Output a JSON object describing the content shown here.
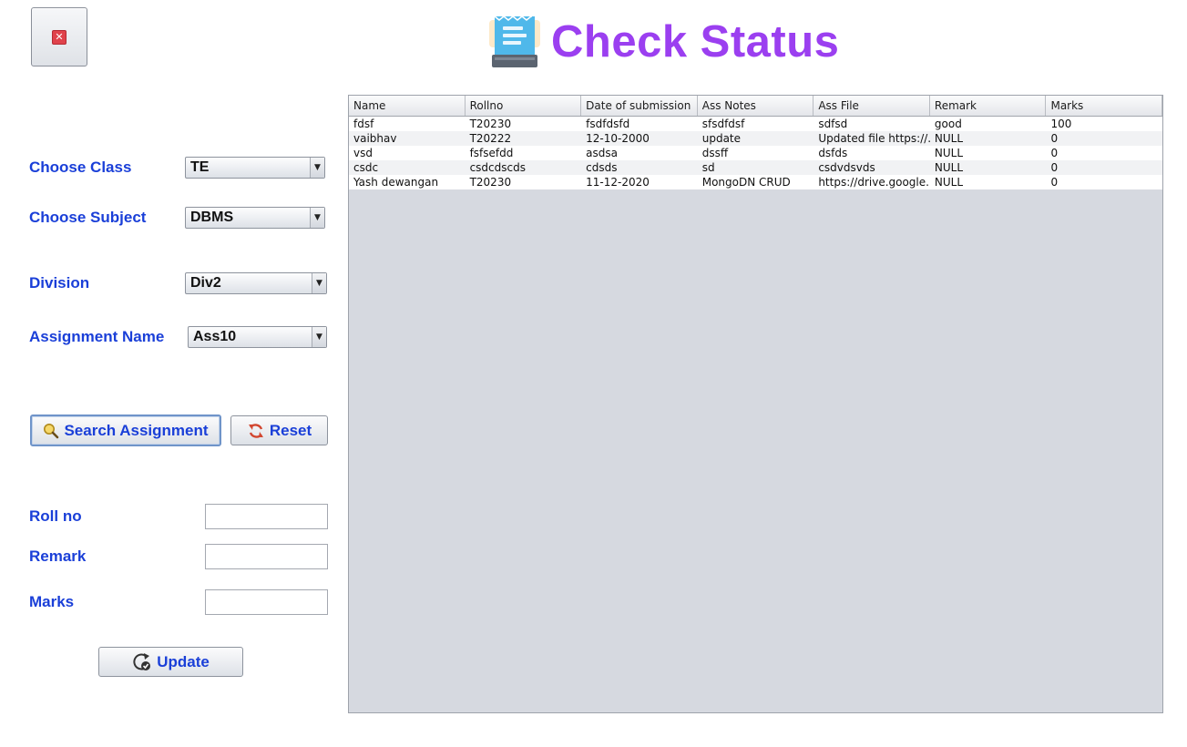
{
  "window": {
    "close_icon": "close-icon"
  },
  "header": {
    "title": "Check Status",
    "icon": "receipt-icon",
    "title_color": "#9b3ff0"
  },
  "form": {
    "class_label": "Choose Class",
    "class_value": "TE",
    "subject_label": "Choose Subject",
    "subject_value": "DBMS",
    "division_label": "Division",
    "division_value": "Div2",
    "assignment_label": "Assignment Name",
    "assignment_value": "Ass10",
    "search_button": "Search Assignment",
    "reset_button": "Reset",
    "rollno_label": "Roll no",
    "remark_label": "Remark",
    "marks_label": "Marks",
    "rollno_value": "",
    "remark_value": "",
    "marks_value": "",
    "update_button": "Update",
    "label_color": "#1a3fd8"
  },
  "table": {
    "columns": [
      "Name",
      "Rollno",
      "Date of submission",
      "Ass Notes",
      "Ass File",
      "Remark",
      "Marks"
    ],
    "rows": [
      [
        "fdsf",
        "T20230",
        "fsdfdsfd",
        "sfsdfdsf",
        "sdfsd",
        "good",
        "100"
      ],
      [
        "vaibhav",
        "T20222",
        "12-10-2000",
        "update",
        "Updated file https://...",
        "NULL",
        "0"
      ],
      [
        "vsd",
        "fsfsefdd",
        "asdsa",
        "dssff",
        "dsfds",
        "NULL",
        "0"
      ],
      [
        "csdc",
        "csdcdscds",
        "cdsds",
        "sd",
        "csdvdsvds",
        "NULL",
        "0"
      ],
      [
        "Yash dewangan",
        "T20230",
        "11-12-2020",
        "MongoDN CRUD",
        "https://drive.google....",
        "NULL",
        "0"
      ]
    ]
  }
}
